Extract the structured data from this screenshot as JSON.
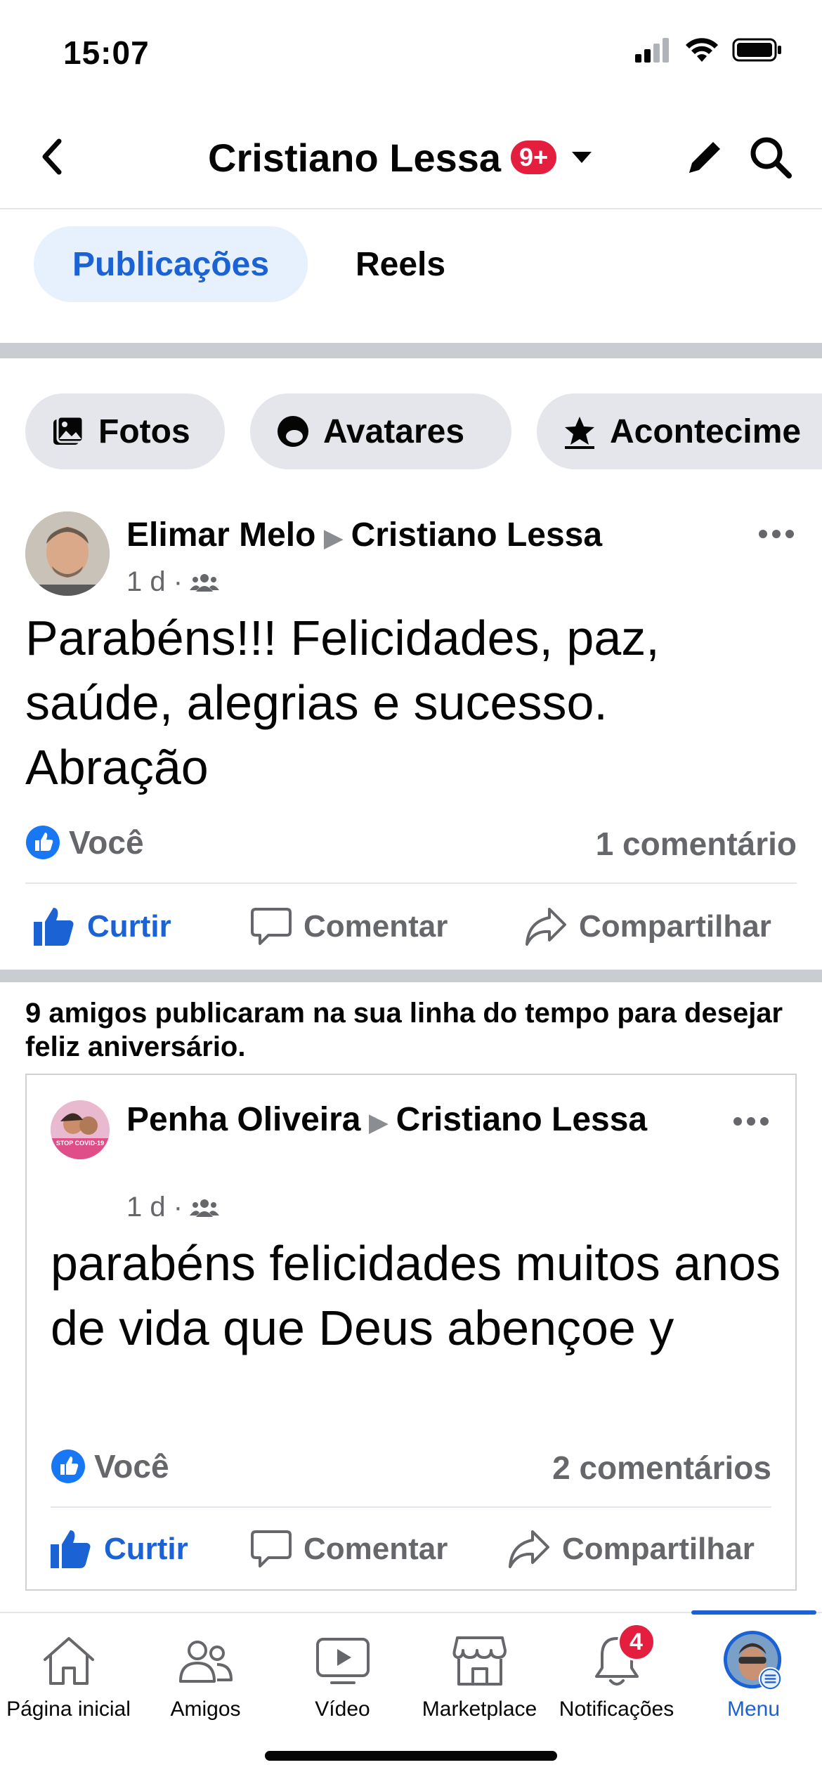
{
  "status": {
    "time": "15:07"
  },
  "header": {
    "title": "Cristiano Lessa",
    "badge": "9+"
  },
  "tabs": [
    {
      "label": "Publicações",
      "active": true
    },
    {
      "label": "Reels",
      "active": false
    }
  ],
  "chips": [
    {
      "label": "Fotos",
      "icon": "photos-icon"
    },
    {
      "label": "Avatares",
      "icon": "avatar-icon"
    },
    {
      "label": "Acontecime",
      "icon": "event-star-icon"
    }
  ],
  "post1": {
    "author": "Elimar Melo",
    "target": "Cristiano Lessa",
    "time": "1 d ·",
    "text": "Parabéns!!! Felicidades, paz, saúde, alegrias e sucesso. Abração",
    "reactions": "Você",
    "comments": "1 comentário",
    "actions": {
      "like": "Curtir",
      "comment": "Comentar",
      "share": "Compartilhar"
    }
  },
  "birthday_note": {
    "part1": "9 amigos publicaram na sua ",
    "bold": "linha do tempo",
    "part2": " para desejar feliz aniversário."
  },
  "post2": {
    "author": "Penha Oliveira",
    "target": "Cristiano Lessa",
    "time": "1 d ·",
    "text": "parabéns felicidades muitos anos de vida que Deus abençoe y",
    "avatar_text": "STOP COVID-19",
    "reactions": "Você",
    "comments": "2 comentários",
    "actions": {
      "like": "Curtir",
      "comment": "Comentar",
      "share": "Compartilhar"
    }
  },
  "bottom_nav": [
    {
      "label": "Página inicial",
      "icon": "home-icon"
    },
    {
      "label": "Amigos",
      "icon": "friends-icon"
    },
    {
      "label": "Vídeo",
      "icon": "video-icon"
    },
    {
      "label": "Marketplace",
      "icon": "marketplace-icon"
    },
    {
      "label": "Notificações",
      "icon": "bell-icon",
      "badge": "4"
    },
    {
      "label": "Menu",
      "icon": "profile-menu-icon",
      "active": true
    }
  ],
  "colors": {
    "accent": "#1b62d4",
    "badge": "#e41e3f",
    "muted": "#65676b"
  }
}
